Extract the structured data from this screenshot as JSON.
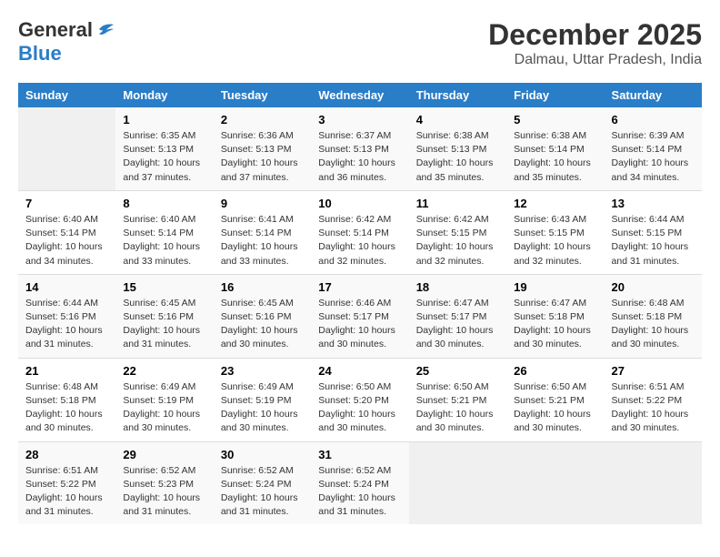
{
  "header": {
    "logo_general": "General",
    "logo_blue": "Blue",
    "month": "December 2025",
    "location": "Dalmau, Uttar Pradesh, India"
  },
  "days_of_week": [
    "Sunday",
    "Monday",
    "Tuesday",
    "Wednesday",
    "Thursday",
    "Friday",
    "Saturday"
  ],
  "weeks": [
    [
      {
        "day": "",
        "sunrise": "",
        "sunset": "",
        "daylight": ""
      },
      {
        "day": "1",
        "sunrise": "Sunrise: 6:35 AM",
        "sunset": "Sunset: 5:13 PM",
        "daylight": "Daylight: 10 hours and 37 minutes."
      },
      {
        "day": "2",
        "sunrise": "Sunrise: 6:36 AM",
        "sunset": "Sunset: 5:13 PM",
        "daylight": "Daylight: 10 hours and 37 minutes."
      },
      {
        "day": "3",
        "sunrise": "Sunrise: 6:37 AM",
        "sunset": "Sunset: 5:13 PM",
        "daylight": "Daylight: 10 hours and 36 minutes."
      },
      {
        "day": "4",
        "sunrise": "Sunrise: 6:38 AM",
        "sunset": "Sunset: 5:13 PM",
        "daylight": "Daylight: 10 hours and 35 minutes."
      },
      {
        "day": "5",
        "sunrise": "Sunrise: 6:38 AM",
        "sunset": "Sunset: 5:14 PM",
        "daylight": "Daylight: 10 hours and 35 minutes."
      },
      {
        "day": "6",
        "sunrise": "Sunrise: 6:39 AM",
        "sunset": "Sunset: 5:14 PM",
        "daylight": "Daylight: 10 hours and 34 minutes."
      }
    ],
    [
      {
        "day": "7",
        "sunrise": "Sunrise: 6:40 AM",
        "sunset": "Sunset: 5:14 PM",
        "daylight": "Daylight: 10 hours and 34 minutes."
      },
      {
        "day": "8",
        "sunrise": "Sunrise: 6:40 AM",
        "sunset": "Sunset: 5:14 PM",
        "daylight": "Daylight: 10 hours and 33 minutes."
      },
      {
        "day": "9",
        "sunrise": "Sunrise: 6:41 AM",
        "sunset": "Sunset: 5:14 PM",
        "daylight": "Daylight: 10 hours and 33 minutes."
      },
      {
        "day": "10",
        "sunrise": "Sunrise: 6:42 AM",
        "sunset": "Sunset: 5:14 PM",
        "daylight": "Daylight: 10 hours and 32 minutes."
      },
      {
        "day": "11",
        "sunrise": "Sunrise: 6:42 AM",
        "sunset": "Sunset: 5:15 PM",
        "daylight": "Daylight: 10 hours and 32 minutes."
      },
      {
        "day": "12",
        "sunrise": "Sunrise: 6:43 AM",
        "sunset": "Sunset: 5:15 PM",
        "daylight": "Daylight: 10 hours and 32 minutes."
      },
      {
        "day": "13",
        "sunrise": "Sunrise: 6:44 AM",
        "sunset": "Sunset: 5:15 PM",
        "daylight": "Daylight: 10 hours and 31 minutes."
      }
    ],
    [
      {
        "day": "14",
        "sunrise": "Sunrise: 6:44 AM",
        "sunset": "Sunset: 5:16 PM",
        "daylight": "Daylight: 10 hours and 31 minutes."
      },
      {
        "day": "15",
        "sunrise": "Sunrise: 6:45 AM",
        "sunset": "Sunset: 5:16 PM",
        "daylight": "Daylight: 10 hours and 31 minutes."
      },
      {
        "day": "16",
        "sunrise": "Sunrise: 6:45 AM",
        "sunset": "Sunset: 5:16 PM",
        "daylight": "Daylight: 10 hours and 30 minutes."
      },
      {
        "day": "17",
        "sunrise": "Sunrise: 6:46 AM",
        "sunset": "Sunset: 5:17 PM",
        "daylight": "Daylight: 10 hours and 30 minutes."
      },
      {
        "day": "18",
        "sunrise": "Sunrise: 6:47 AM",
        "sunset": "Sunset: 5:17 PM",
        "daylight": "Daylight: 10 hours and 30 minutes."
      },
      {
        "day": "19",
        "sunrise": "Sunrise: 6:47 AM",
        "sunset": "Sunset: 5:18 PM",
        "daylight": "Daylight: 10 hours and 30 minutes."
      },
      {
        "day": "20",
        "sunrise": "Sunrise: 6:48 AM",
        "sunset": "Sunset: 5:18 PM",
        "daylight": "Daylight: 10 hours and 30 minutes."
      }
    ],
    [
      {
        "day": "21",
        "sunrise": "Sunrise: 6:48 AM",
        "sunset": "Sunset: 5:18 PM",
        "daylight": "Daylight: 10 hours and 30 minutes."
      },
      {
        "day": "22",
        "sunrise": "Sunrise: 6:49 AM",
        "sunset": "Sunset: 5:19 PM",
        "daylight": "Daylight: 10 hours and 30 minutes."
      },
      {
        "day": "23",
        "sunrise": "Sunrise: 6:49 AM",
        "sunset": "Sunset: 5:19 PM",
        "daylight": "Daylight: 10 hours and 30 minutes."
      },
      {
        "day": "24",
        "sunrise": "Sunrise: 6:50 AM",
        "sunset": "Sunset: 5:20 PM",
        "daylight": "Daylight: 10 hours and 30 minutes."
      },
      {
        "day": "25",
        "sunrise": "Sunrise: 6:50 AM",
        "sunset": "Sunset: 5:21 PM",
        "daylight": "Daylight: 10 hours and 30 minutes."
      },
      {
        "day": "26",
        "sunrise": "Sunrise: 6:50 AM",
        "sunset": "Sunset: 5:21 PM",
        "daylight": "Daylight: 10 hours and 30 minutes."
      },
      {
        "day": "27",
        "sunrise": "Sunrise: 6:51 AM",
        "sunset": "Sunset: 5:22 PM",
        "daylight": "Daylight: 10 hours and 30 minutes."
      }
    ],
    [
      {
        "day": "28",
        "sunrise": "Sunrise: 6:51 AM",
        "sunset": "Sunset: 5:22 PM",
        "daylight": "Daylight: 10 hours and 31 minutes."
      },
      {
        "day": "29",
        "sunrise": "Sunrise: 6:52 AM",
        "sunset": "Sunset: 5:23 PM",
        "daylight": "Daylight: 10 hours and 31 minutes."
      },
      {
        "day": "30",
        "sunrise": "Sunrise: 6:52 AM",
        "sunset": "Sunset: 5:24 PM",
        "daylight": "Daylight: 10 hours and 31 minutes."
      },
      {
        "day": "31",
        "sunrise": "Sunrise: 6:52 AM",
        "sunset": "Sunset: 5:24 PM",
        "daylight": "Daylight: 10 hours and 31 minutes."
      },
      {
        "day": "",
        "sunrise": "",
        "sunset": "",
        "daylight": ""
      },
      {
        "day": "",
        "sunrise": "",
        "sunset": "",
        "daylight": ""
      },
      {
        "day": "",
        "sunrise": "",
        "sunset": "",
        "daylight": ""
      }
    ]
  ]
}
